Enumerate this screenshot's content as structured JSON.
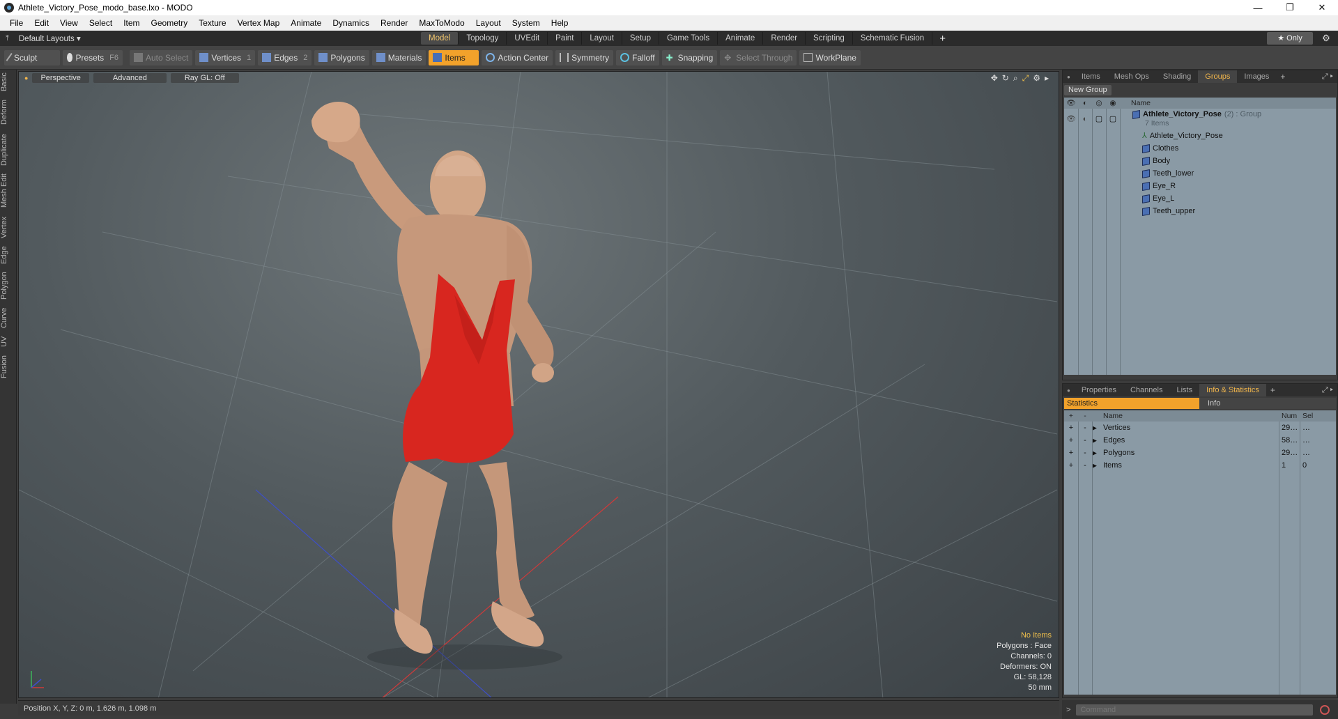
{
  "window": {
    "title": "Athlete_Victory_Pose_modo_base.lxo - MODO",
    "controls": [
      "—",
      "❐",
      "✕"
    ]
  },
  "menu": [
    "File",
    "Edit",
    "View",
    "Select",
    "Item",
    "Geometry",
    "Texture",
    "Vertex Map",
    "Animate",
    "Dynamics",
    "Render",
    "MaxToModo",
    "Layout",
    "System",
    "Help"
  ],
  "layoutbar": {
    "layouts_label": "Default Layouts ▾",
    "tabs": [
      "Model",
      "Topology",
      "UVEdit",
      "Paint",
      "Layout",
      "Setup",
      "Game Tools",
      "Animate",
      "Render",
      "Scripting",
      "Schematic Fusion"
    ],
    "active_tab": "Model",
    "only_label": "★  Only"
  },
  "toolbar": {
    "sculpt": "Sculpt",
    "presets": "Presets",
    "presets_key": "F6",
    "auto_select": "Auto Select",
    "vertices": "Vertices",
    "vertices_count": "1",
    "edges": "Edges",
    "edges_count": "2",
    "polygons": "Polygons",
    "materials": "Materials",
    "items": "Items",
    "action_center": "Action Center",
    "symmetry": "Symmetry",
    "falloff": "Falloff",
    "snapping": "Snapping",
    "select_through": "Select Through",
    "workplane": "WorkPlane"
  },
  "left_tabs": [
    "Basic",
    "Deform",
    "Duplicate",
    "Mesh Edit",
    "Vertex",
    "Edge",
    "Polygon",
    "Curve",
    "UV",
    "Fusion"
  ],
  "viewport": {
    "perspective": "Perspective",
    "advanced": "Advanced",
    "raygl": "Ray GL: Off",
    "info": {
      "no_items": "No Items",
      "polygons": "Polygons : Face",
      "channels": "Channels: 0",
      "deformers": "Deformers: ON",
      "gl": "GL: 58,128",
      "mm": "50 mm"
    }
  },
  "status": {
    "position": "Position X, Y, Z:  0 m, 1.626 m, 1.098 m"
  },
  "groups_panel": {
    "tabs": [
      "Items",
      "Mesh Ops",
      "Shading",
      "Groups",
      "Images"
    ],
    "active_tab": "Groups",
    "new_group": "New Group",
    "col_name": "Name",
    "group_name": "Athlete_Victory_Pose",
    "group_suffix": "(2) : Group",
    "group_count": "7 Items",
    "children": [
      "Athlete_Victory_Pose",
      "Clothes",
      "Body",
      "Teeth_lower",
      "Eye_R",
      "Eye_L",
      "Teeth_upper"
    ]
  },
  "stats_panel": {
    "tabs": [
      "Properties",
      "Channels",
      "Lists",
      "Info & Statistics"
    ],
    "active_tab": "Info & Statistics",
    "subtabs": [
      "Statistics",
      "Info"
    ],
    "cols": [
      "Name",
      "Num",
      "Sel"
    ],
    "rows": [
      {
        "name": "Vertices",
        "num": "29…",
        "sel": "…"
      },
      {
        "name": "Edges",
        "num": "58…",
        "sel": "…"
      },
      {
        "name": "Polygons",
        "num": "29…",
        "sel": "…"
      },
      {
        "name": "Items",
        "num": "1",
        "sel": "0"
      }
    ]
  },
  "command": {
    "placeholder": "Command"
  }
}
